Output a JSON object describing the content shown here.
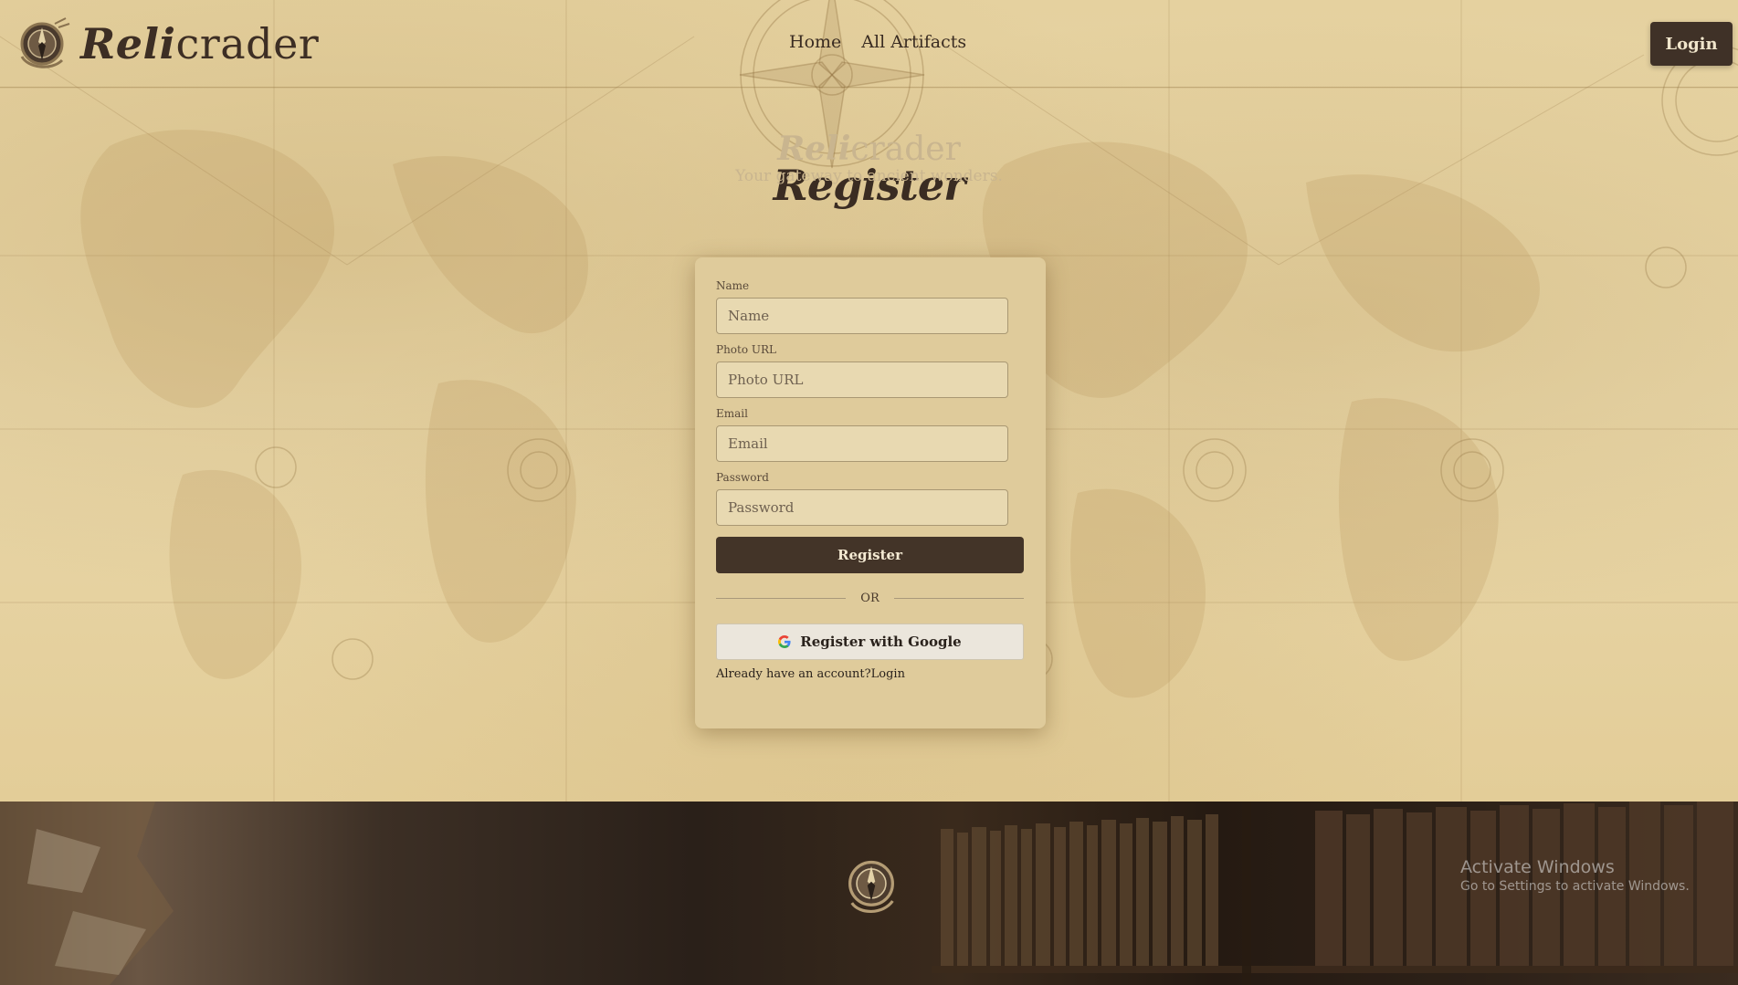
{
  "header": {
    "brand_bold": "Reli",
    "brand_rest": "crader",
    "nav": [
      {
        "label": "Home"
      },
      {
        "label": "All Artifacts"
      }
    ],
    "login_label": "Login"
  },
  "page": {
    "title": "Register"
  },
  "form": {
    "name_label": "Name",
    "name_placeholder": "Name",
    "photo_label": "Photo URL",
    "photo_placeholder": "Photo URL",
    "email_label": "Email",
    "email_placeholder": "Email",
    "password_label": "Password",
    "password_placeholder": "Password",
    "register_label": "Register",
    "or_text": "OR",
    "google_label": "Register with Google",
    "account_prompt": "Already have an account?",
    "account_login_link": "Login"
  },
  "footer": {
    "brand_bold": "Reli",
    "brand_rest": "crader",
    "tagline": "Your gateway to ancient wonders."
  },
  "os_overlay": {
    "title": "Activate Windows",
    "subtitle": "Go to Settings to activate Windows."
  },
  "colors": {
    "parchment": "#e6d3a3",
    "dark_brown": "#3f3127",
    "card": "#dfcb9b"
  },
  "icons": {
    "logo": "compass-emblem-icon",
    "google": "google-g-icon"
  }
}
